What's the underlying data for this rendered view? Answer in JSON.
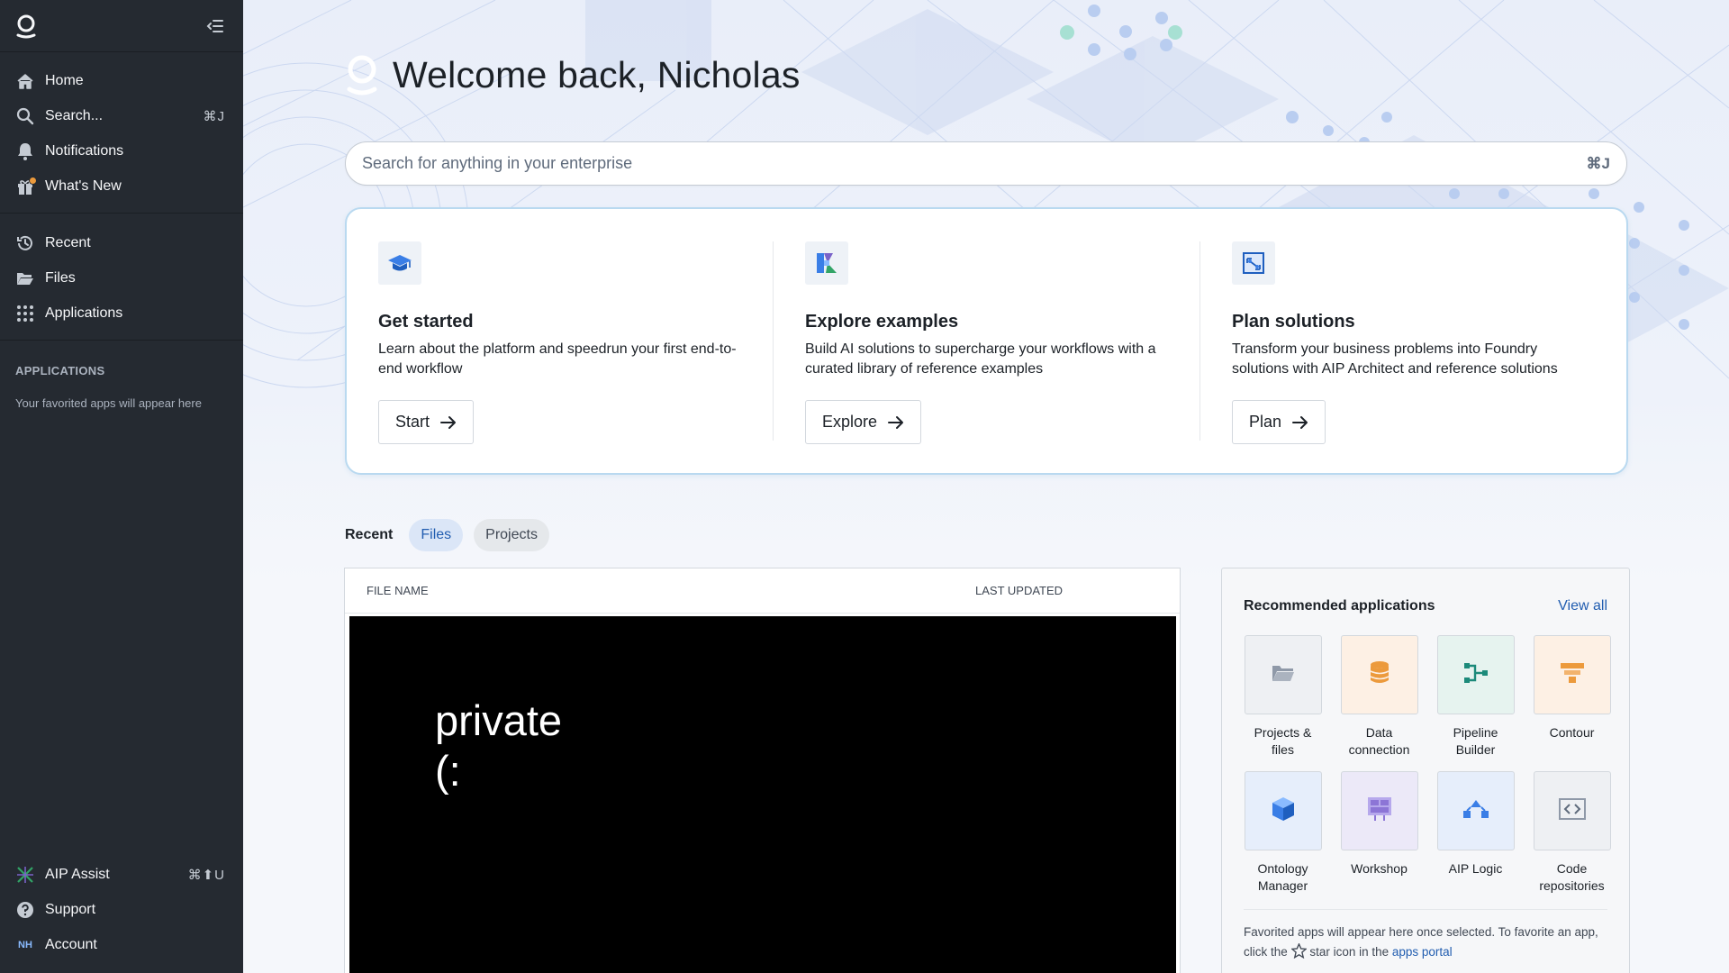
{
  "sidebar": {
    "nav": [
      {
        "label": "Home"
      },
      {
        "label": "Search...",
        "shortcut": "⌘J"
      },
      {
        "label": "Notifications"
      },
      {
        "label": "What's New"
      }
    ],
    "nav2": [
      {
        "label": "Recent"
      },
      {
        "label": "Files"
      },
      {
        "label": "Applications"
      }
    ],
    "section_title": "APPLICATIONS",
    "section_hint": "Your favorited apps will appear here",
    "bottom": [
      {
        "label": "AIP Assist",
        "shortcut": "⌘⬆U"
      },
      {
        "label": "Support"
      },
      {
        "label": "Account",
        "initials": "NH"
      }
    ]
  },
  "welcome": {
    "title": "Welcome back, Nicholas"
  },
  "search": {
    "placeholder": "Search for anything in your enterprise",
    "shortcut": "⌘J"
  },
  "cards": [
    {
      "title": "Get started",
      "description": "Learn about the platform and speedrun your first end-to-end workflow",
      "button": "Start"
    },
    {
      "title": "Explore examples",
      "description": "Build AI solutions to supercharge your workflows with a curated library of reference examples",
      "button": "Explore"
    },
    {
      "title": "Plan solutions",
      "description": "Transform your business problems into Foundry solutions with AIP Architect and reference solutions",
      "button": "Plan"
    }
  ],
  "recent_tabs": {
    "label": "Recent",
    "tabs": [
      "Files",
      "Projects"
    ],
    "active": "Files"
  },
  "table": {
    "columns": [
      "FILE NAME",
      "LAST UPDATED"
    ],
    "redaction_line1": "private",
    "redaction_line2": "(:"
  },
  "recommended": {
    "title": "Recommended applications",
    "view_all": "View all",
    "apps": [
      {
        "name_line1": "Projects &",
        "name_line2": "files",
        "icon": "folder-icon",
        "tile_bg": "#eef0f3",
        "color": "#8f99a8"
      },
      {
        "name_line1": "Data",
        "name_line2": "connection",
        "icon": "database-icon",
        "tile_bg": "#fdf0e4",
        "color": "#ec9a3c"
      },
      {
        "name_line1": "Pipeline",
        "name_line2": "Builder",
        "icon": "pipeline-icon",
        "tile_bg": "#e6f3ef",
        "color": "#1c8a7a"
      },
      {
        "name_line1": "Contour",
        "name_line2": "",
        "icon": "contour-icon",
        "tile_bg": "#fdf0e4",
        "color": "#ec9a3c"
      },
      {
        "name_line1": "Ontology",
        "name_line2": "Manager",
        "icon": "cube-icon",
        "tile_bg": "#e6eefb",
        "color": "#3a7ee6"
      },
      {
        "name_line1": "Workshop",
        "name_line2": "",
        "icon": "workshop-icon",
        "tile_bg": "#ece9f8",
        "color": "#8c75d6"
      },
      {
        "name_line1": "AIP Logic",
        "name_line2": "",
        "icon": "logic-icon",
        "tile_bg": "#e6eefb",
        "color": "#3a7ee6"
      },
      {
        "name_line1": "Code",
        "name_line2": "repositories",
        "icon": "code-icon",
        "tile_bg": "#eef0f3",
        "color": "#8f99a8"
      }
    ],
    "footer_part1": "Favorited apps will appear here once selected. To favorite an app, click the",
    "footer_part2": "star icon in the",
    "footer_link": "apps portal"
  }
}
